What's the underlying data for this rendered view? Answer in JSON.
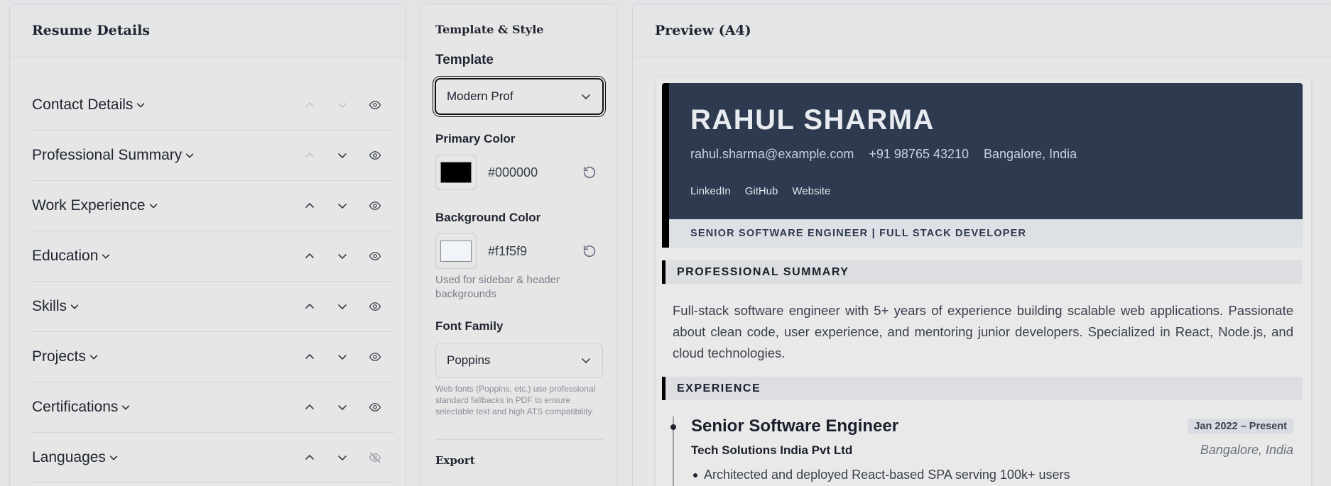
{
  "left_panel": {
    "title": "Resume Details",
    "sections": [
      {
        "label": "Contact Details",
        "up_enabled": false,
        "down_enabled": false,
        "visible": true
      },
      {
        "label": "Professional Summary",
        "up_enabled": false,
        "down_enabled": true,
        "visible": true
      },
      {
        "label": "Work Experience",
        "up_enabled": true,
        "down_enabled": true,
        "visible": true
      },
      {
        "label": "Education",
        "up_enabled": true,
        "down_enabled": true,
        "visible": true
      },
      {
        "label": "Skills",
        "up_enabled": true,
        "down_enabled": true,
        "visible": true
      },
      {
        "label": "Projects",
        "up_enabled": true,
        "down_enabled": true,
        "visible": true
      },
      {
        "label": "Certifications",
        "up_enabled": true,
        "down_enabled": true,
        "visible": true
      },
      {
        "label": "Languages",
        "up_enabled": true,
        "down_enabled": true,
        "visible": false
      }
    ]
  },
  "middle_panel": {
    "title": "Template & Style",
    "template_label": "Template",
    "template_value": "Modern Prof",
    "primary_color_label": "Primary Color",
    "primary_color": "#000000",
    "background_color_label": "Background Color",
    "background_color": "#f1f5f9",
    "background_hint": "Used for sidebar & header backgrounds",
    "font_family_label": "Font Family",
    "font_family_value": "Poppins",
    "font_hint": "Web fonts (Poppins, etc.) use professional standard fallbacks in PDF to ensure selectable text and high ATS compatibility.",
    "next_heading": "Export"
  },
  "preview": {
    "title": "Preview (A4)",
    "name": "RAHUL SHARMA",
    "contact": [
      "rahul.sharma@example.com",
      "+91 98765 43210",
      "Bangalore, India"
    ],
    "links": [
      "LinkedIn",
      "GitHub",
      "Website"
    ],
    "tagline": "SENIOR SOFTWARE ENGINEER | FULL STACK DEVELOPER",
    "summary_heading": "PROFESSIONAL SUMMARY",
    "summary": "Full-stack software engineer with 5+ years of experience building scalable web applications. Passionate about clean code, user experience, and mentoring junior developers. Specialized in React, Node.js, and cloud technologies.",
    "experience_heading": "EXPERIENCE",
    "job": {
      "title": "Senior Software Engineer",
      "dates": "Jan 2022 – Present",
      "company": "Tech Solutions India Pvt Ltd",
      "location": "Bangalore, India",
      "bullet": "Architected and deployed React-based SPA serving 100k+ users"
    }
  },
  "colors": {
    "header_bg": "#2e3a4f",
    "accent": "#000000"
  }
}
